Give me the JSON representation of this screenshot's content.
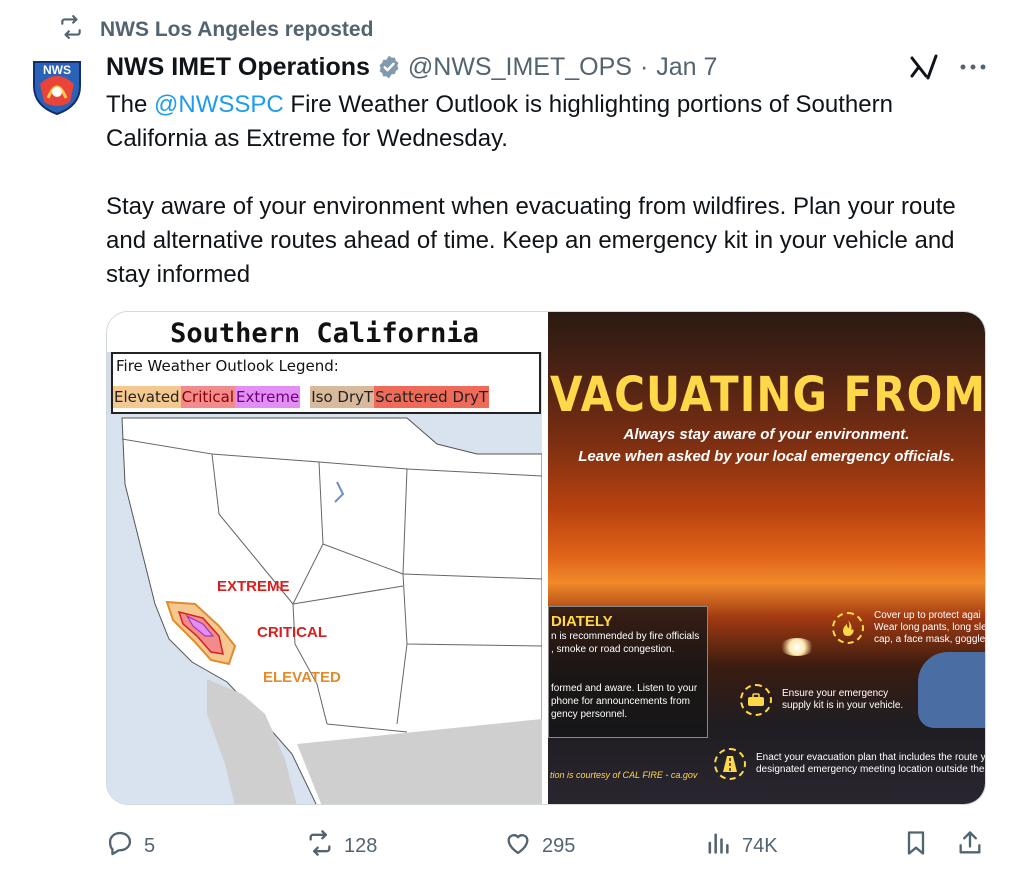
{
  "repost": {
    "text": "NWS Los Angeles reposted",
    "icon": "repost-icon"
  },
  "author": {
    "name": "NWS IMET Operations",
    "handle": "@NWS_IMET_OPS",
    "separator": "·",
    "date": "Jan 7",
    "avatar_text": "NWS",
    "verified_icon": "verified-badge-icon",
    "verified_color": "#829aab"
  },
  "tweet": {
    "line1_prefix": "The ",
    "mention": "@NWSSPC",
    "line1_suffix": " Fire Weather Outlook is highlighting portions of Southern California as Extreme for Wednesday.",
    "paragraph2": "Stay aware of your environment when evacuating from wildfires. Plan your route and alternative routes ahead of time. Keep an emergency kit in your vehicle and stay informed",
    "mention_color": "#1d9bf0"
  },
  "media": {
    "map": {
      "title": "Southern California",
      "legend_title": "Fire Weather Outlook Legend:",
      "legend_items": [
        "Elevated",
        "Critical",
        "Extreme",
        "Iso DryT",
        "Scattered DryT"
      ],
      "labels": {
        "extreme": "EXTREME",
        "critical": "CRITICAL",
        "elevated": "ELEVATED"
      },
      "colors": {
        "extreme": "#d92020",
        "critical": "#d92020",
        "elevated": "#e38b2c"
      }
    },
    "wildfire": {
      "title": "VACUATING FROM WILDFIRE",
      "subtitle_1": "Always stay aware of your environment.",
      "subtitle_2": "Leave when asked by your local emergency officials.",
      "box_heading": "DIATELY",
      "box_line1": "n is recommended by fire officials",
      "box_line2": ", smoke or road congestion.",
      "box_line3": "formed and aware. Listen to your",
      "box_line4": "phone for announcements from",
      "box_line5": "gency personnel.",
      "credit": "tion is courtesy of CAL FIRE - ca.gov",
      "tip1_line1": "Cover up to protect agai",
      "tip1_line2": "Wear long pants, long sle",
      "tip1_line3": "cap, a face mask, goggle",
      "tip2_line1": "Ensure your emergency",
      "tip2_line2": "supply kit is in your vehicle.",
      "tip3_line1": "Enact your evacuation plan that includes the route yo",
      "tip3_line2": "designated emergency meeting location outside the f"
    }
  },
  "actions": {
    "replies": "5",
    "reposts": "128",
    "likes": "295",
    "views": "74K",
    "icons": [
      "reply-icon",
      "repost-icon",
      "like-icon",
      "views-icon",
      "bookmark-icon",
      "share-icon"
    ]
  }
}
